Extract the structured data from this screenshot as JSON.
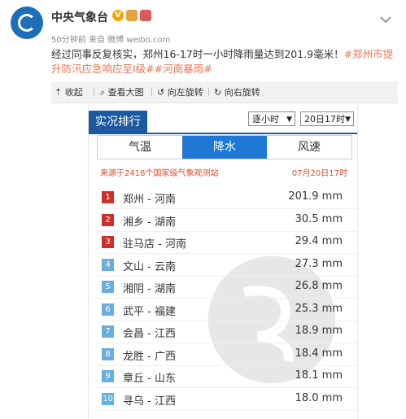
{
  "post": {
    "username": "中央气象台",
    "verified_mark": "V",
    "meta": "50分钟前 来自 微博 weibo.com",
    "text_main": "经过同事反复核实，郑州16-17时一小时降雨量达到201.9毫米！",
    "tag1": "#郑州市提升防汛应急响应至Ⅰ级#",
    "tag2": "#河南暴雨#"
  },
  "toolbar": {
    "collapse": "收起",
    "view_large": "查看大图",
    "rotate_left": "向左旋转",
    "rotate_right": "向右旋转"
  },
  "ranking": {
    "title": "实况排行",
    "interval_select": "逐小时",
    "time_select": "20日17时",
    "tabs": [
      {
        "label": "气温",
        "active": false
      },
      {
        "label": "降水",
        "active": true
      },
      {
        "label": "风速",
        "active": false
      }
    ],
    "source": "来源于2418个国家级气象观测站",
    "timestamp": "07月20日17时",
    "rows": [
      {
        "rank": "1",
        "station": "郑州 - 河南",
        "value": "201.9 mm",
        "color": "#d0302c"
      },
      {
        "rank": "2",
        "station": "湘乡 - 湖南",
        "value": "30.5 mm",
        "color": "#d0302c"
      },
      {
        "rank": "3",
        "station": "驻马店 - 河南",
        "value": "29.4 mm",
        "color": "#d0302c"
      },
      {
        "rank": "4",
        "station": "文山 - 云南",
        "value": "27.3 mm",
        "color": "#6aaee0"
      },
      {
        "rank": "5",
        "station": "湘阴 - 湖南",
        "value": "26.8 mm",
        "color": "#6aaee0"
      },
      {
        "rank": "6",
        "station": "武平 - 福建",
        "value": "25.3 mm",
        "color": "#6aaee0"
      },
      {
        "rank": "7",
        "station": "会昌 - 江西",
        "value": "18.9 mm",
        "color": "#6aaee0"
      },
      {
        "rank": "8",
        "station": "龙胜 - 广西",
        "value": "18.4 mm",
        "color": "#6aaee0"
      },
      {
        "rank": "9",
        "station": "章丘 - 山东",
        "value": "18.1 mm",
        "color": "#6aaee0"
      },
      {
        "rank": "10",
        "station": "寻乌 - 江西",
        "value": "18.0 mm",
        "color": "#6aaee0"
      }
    ]
  },
  "colors": {
    "accent_blue": "#1d79d4",
    "title_blue": "#1c5aa0",
    "link_orange": "#eb7350",
    "source_red": "#e04a2c"
  }
}
